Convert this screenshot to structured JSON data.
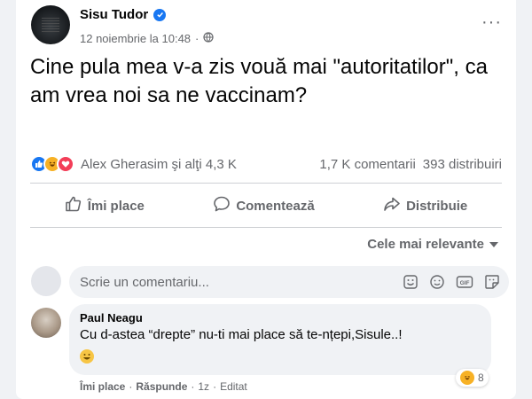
{
  "post": {
    "author": "Sisu Tudor",
    "date": "12 noiembrie la 10:48",
    "separator": "·",
    "text": "Cine pula mea v-a zis vouă mai \"autoritatilor\", ca am vrea noi sa ne vaccinam?",
    "reactions_summary": "Alex Gherasim şi alţi 4,3 K",
    "comments_count": "1,7 K comentarii",
    "shares_count": "393 distribuiri",
    "reaction_icons": [
      "like-icon",
      "haha-icon",
      "love-icon"
    ]
  },
  "actions": {
    "like_label": "Îmi place",
    "comment_label": "Comentează",
    "share_label": "Distribuie"
  },
  "comments_section": {
    "sort_label": "Cele mai relevante",
    "input_placeholder": "Scrie un comentariu...",
    "input_icons": [
      "sticker-smile-icon",
      "camera-icon",
      "gif-icon",
      "sticker-icon"
    ]
  },
  "comment": {
    "author": "Paul Neagu",
    "text": "Cu d-astea “drepte” nu-ti mai place să te-nțepi,Sisule..!",
    "emoji": "😀",
    "reaction_count": "8",
    "like_label": "Îmi place",
    "reply_label": "Răspunde",
    "time": "1z",
    "edited_label": "Editat",
    "dot": "·"
  },
  "colors": {
    "accent": "#1877f2",
    "secondary_text": "#65676b",
    "bubble_bg": "#f0f2f5",
    "love": "#f33e58",
    "haha": "#f7b125"
  }
}
